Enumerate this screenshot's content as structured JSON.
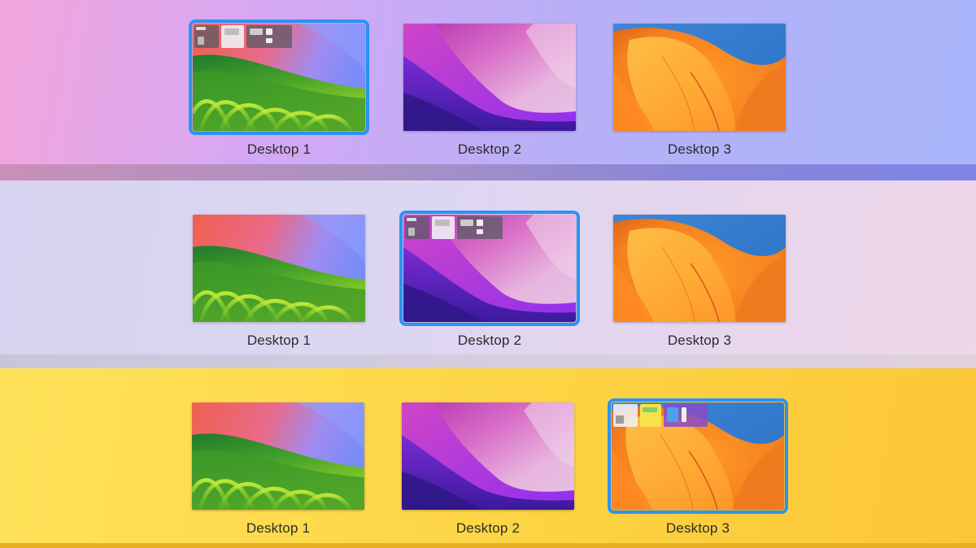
{
  "rows": [
    {
      "id": "row-1",
      "selected_index": 0,
      "spaces": [
        {
          "label": "Desktop 1",
          "wallpaper": "sonoma"
        },
        {
          "label": "Desktop 2",
          "wallpaper": "monterey"
        },
        {
          "label": "Desktop 3",
          "wallpaper": "ventura"
        }
      ]
    },
    {
      "id": "row-2",
      "selected_index": 1,
      "spaces": [
        {
          "label": "Desktop 1",
          "wallpaper": "sonoma"
        },
        {
          "label": "Desktop 2",
          "wallpaper": "monterey"
        },
        {
          "label": "Desktop 3",
          "wallpaper": "ventura"
        }
      ]
    },
    {
      "id": "row-3",
      "selected_index": 2,
      "spaces": [
        {
          "label": "Desktop 1",
          "wallpaper": "sonoma"
        },
        {
          "label": "Desktop 2",
          "wallpaper": "monterey"
        },
        {
          "label": "Desktop 3",
          "wallpaper": "ventura"
        }
      ]
    }
  ],
  "colors": {
    "selection_outline": "#2d92f4",
    "row1_bg": "#c9aef5",
    "row2_bg": "#ddd6f2",
    "row3_bg": "#fdd444"
  }
}
